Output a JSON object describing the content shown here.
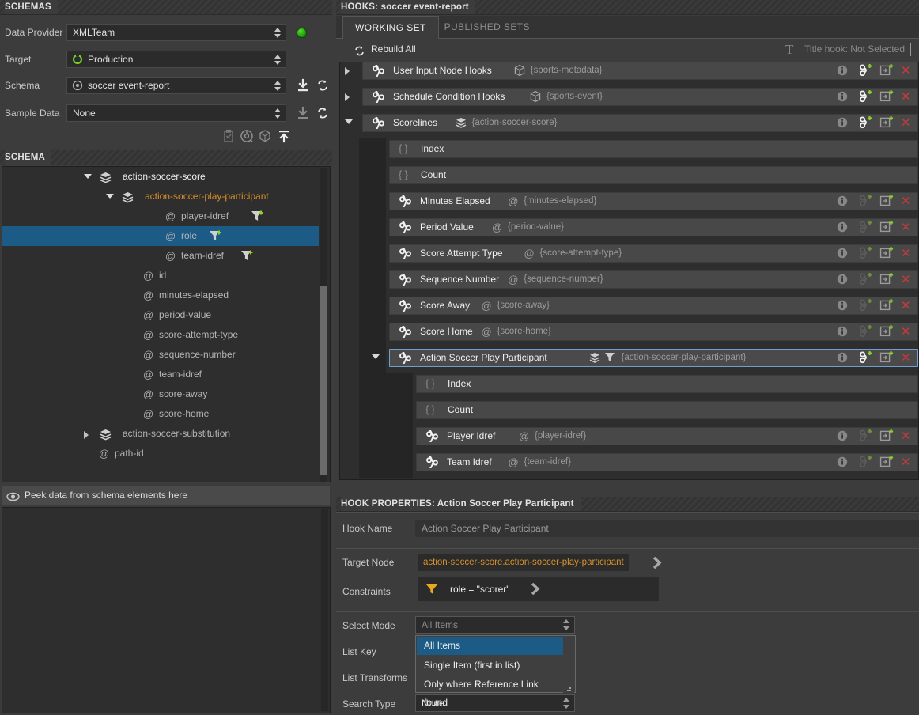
{
  "panels": {
    "schemas_title": "SCHEMAS",
    "schema_title": "SCHEMA",
    "hooks_title": "HOOKS: soccer event-report",
    "hook_properties_title": "HOOK PROPERTIES: Action Soccer Play Participant"
  },
  "schemas_form": {
    "data_provider_label": "Data Provider",
    "data_provider_value": "XMLTeam",
    "target_label": "Target",
    "target_value": "Production",
    "schema_label": "Schema",
    "schema_value": "soccer event-report",
    "sample_data_label": "Sample Data",
    "sample_data_value": "None",
    "status_color": "#2ecc1a"
  },
  "schema_tree": [
    {
      "label": "action-soccer-score",
      "type": "node",
      "indent": 0,
      "arrow": "open",
      "color": "white",
      "filter": false,
      "selected": false
    },
    {
      "label": "action-soccer-play-participant",
      "type": "node",
      "indent": 1,
      "arrow": "open",
      "color": "orange",
      "filter": false,
      "selected": false
    },
    {
      "label": "player-idref",
      "type": "attribute",
      "indent": 2,
      "arrow": "none",
      "color": "grey",
      "filter": true,
      "selected": false
    },
    {
      "label": "role",
      "type": "attribute",
      "indent": 2,
      "arrow": "none",
      "color": "grey",
      "filter": true,
      "selected": true
    },
    {
      "label": "team-idref",
      "type": "attribute",
      "indent": 2,
      "arrow": "none",
      "color": "grey",
      "filter": true,
      "selected": false
    },
    {
      "label": "id",
      "type": "attribute",
      "indent": 1,
      "arrow": "none",
      "color": "grey",
      "filter": false,
      "selected": false
    },
    {
      "label": "minutes-elapsed",
      "type": "attribute",
      "indent": 1,
      "arrow": "none",
      "color": "grey",
      "filter": false,
      "selected": false
    },
    {
      "label": "period-value",
      "type": "attribute",
      "indent": 1,
      "arrow": "none",
      "color": "grey",
      "filter": false,
      "selected": false
    },
    {
      "label": "score-attempt-type",
      "type": "attribute",
      "indent": 1,
      "arrow": "none",
      "color": "grey",
      "filter": false,
      "selected": false
    },
    {
      "label": "sequence-number",
      "type": "attribute",
      "indent": 1,
      "arrow": "none",
      "color": "grey",
      "filter": false,
      "selected": false
    },
    {
      "label": "team-idref",
      "type": "attribute",
      "indent": 1,
      "arrow": "none",
      "color": "grey",
      "filter": false,
      "selected": false
    },
    {
      "label": "score-away",
      "type": "attribute",
      "indent": 1,
      "arrow": "none",
      "color": "grey",
      "filter": false,
      "selected": false
    },
    {
      "label": "score-home",
      "type": "attribute",
      "indent": 1,
      "arrow": "none",
      "color": "grey",
      "filter": false,
      "selected": false
    },
    {
      "label": "action-soccer-substitution",
      "type": "node",
      "indent": 0,
      "arrow": "closed",
      "color": "grey",
      "filter": false,
      "selected": false
    },
    {
      "label": "path-id",
      "type": "attribute",
      "indent": -1,
      "arrow": "none",
      "color": "grey",
      "filter": false,
      "selected": false
    }
  ],
  "peek": {
    "placeholder": "Peek data from schema elements here"
  },
  "tabs": [
    {
      "label": "WORKING SET",
      "active": true
    },
    {
      "label": "PUBLISHED SETS",
      "active": false
    }
  ],
  "toolbar": {
    "rebuild_label": "Rebuild All",
    "title_hook_label": "Title hook: Not Selected"
  },
  "hook_tree": [
    {
      "label": "User Input Node Hooks",
      "path": "{sports-metadata}",
      "indent": 0,
      "arrow": "closed",
      "typeicon": "cube",
      "link": true,
      "actions": true,
      "link_enabled": true,
      "selected": false
    },
    {
      "label": "Schedule Condition Hooks",
      "path": "{sports-event}",
      "indent": 0,
      "arrow": "closed",
      "typeicon": "cube",
      "link": true,
      "actions": true,
      "link_enabled": true,
      "selected": false
    },
    {
      "label": "Scorelines",
      "path": "{action-soccer-score}",
      "indent": 0,
      "arrow": "open",
      "typeicon": "stack",
      "link": true,
      "actions": true,
      "link_enabled": true,
      "selected": false
    },
    {
      "label": "Index",
      "path": "",
      "indent": 1,
      "arrow": "none",
      "typeicon": "braces",
      "link": false,
      "actions": false,
      "link_enabled": false,
      "selected": false
    },
    {
      "label": "Count",
      "path": "",
      "indent": 1,
      "arrow": "none",
      "typeicon": "braces",
      "link": false,
      "actions": false,
      "link_enabled": false,
      "selected": false
    },
    {
      "label": "Minutes Elapsed",
      "path": "{minutes-elapsed}",
      "indent": 1,
      "arrow": "none",
      "typeicon": "at",
      "link": true,
      "actions": true,
      "link_enabled": false,
      "selected": false
    },
    {
      "label": "Period Value",
      "path": "{period-value}",
      "indent": 1,
      "arrow": "none",
      "typeicon": "at",
      "link": true,
      "actions": true,
      "link_enabled": false,
      "selected": false
    },
    {
      "label": "Score Attempt Type",
      "path": "{score-attempt-type}",
      "indent": 1,
      "arrow": "none",
      "typeicon": "at",
      "link": true,
      "actions": true,
      "link_enabled": false,
      "selected": false
    },
    {
      "label": "Sequence Number",
      "path": "{sequence-number}",
      "indent": 1,
      "arrow": "none",
      "typeicon": "at",
      "link": true,
      "actions": true,
      "link_enabled": false,
      "selected": false
    },
    {
      "label": "Score Away",
      "path": "{score-away}",
      "indent": 1,
      "arrow": "none",
      "typeicon": "at",
      "link": true,
      "actions": true,
      "link_enabled": false,
      "selected": false
    },
    {
      "label": "Score Home",
      "path": "{score-home}",
      "indent": 1,
      "arrow": "none",
      "typeicon": "at",
      "link": true,
      "actions": true,
      "link_enabled": false,
      "selected": false
    },
    {
      "label": "Action Soccer Play Participant",
      "path": "{action-soccer-play-participant}",
      "indent": 1,
      "arrow": "open",
      "typeicon": "stack-filter",
      "link": true,
      "actions": true,
      "link_enabled": true,
      "selected": true
    },
    {
      "label": "Index",
      "path": "",
      "indent": 2,
      "arrow": "none",
      "typeicon": "braces",
      "link": false,
      "actions": false,
      "link_enabled": false,
      "selected": false
    },
    {
      "label": "Count",
      "path": "",
      "indent": 2,
      "arrow": "none",
      "typeicon": "braces",
      "link": false,
      "actions": false,
      "link_enabled": false,
      "selected": false
    },
    {
      "label": "Player Idref",
      "path": "{player-idref}",
      "indent": 2,
      "arrow": "none",
      "typeicon": "at",
      "link": true,
      "actions": true,
      "link_enabled": false,
      "selected": false
    },
    {
      "label": "Team Idref",
      "path": "{team-idref}",
      "indent": 2,
      "arrow": "none",
      "typeicon": "at",
      "link": true,
      "actions": true,
      "link_enabled": false,
      "selected": false
    }
  ],
  "hook_properties": {
    "hook_name_label": "Hook Name",
    "hook_name_value": "Action Soccer Play Participant",
    "target_node_label": "Target Node",
    "target_node_value": "action-soccer-score.action-soccer-play-participant",
    "constraints_label": "Constraints",
    "constraint_value": "role = \"scorer\"",
    "select_mode_label": "Select Mode",
    "select_mode_value": "All Items",
    "list_key_label": "List Key",
    "list_transforms_label": "List Transforms",
    "search_type_label": "Search Type",
    "search_type_value": "None",
    "select_mode_options": [
      {
        "label": "All Items",
        "selected": true
      },
      {
        "label": "Single Item (first in list)",
        "selected": false
      },
      {
        "label": "Only where Reference Link found",
        "selected": false
      }
    ]
  },
  "colors": {
    "accent_orange": "#d88e28",
    "selection_blue": "#1d5b87",
    "delete_red": "#c23b3b",
    "add_green": "#8bd22b"
  }
}
